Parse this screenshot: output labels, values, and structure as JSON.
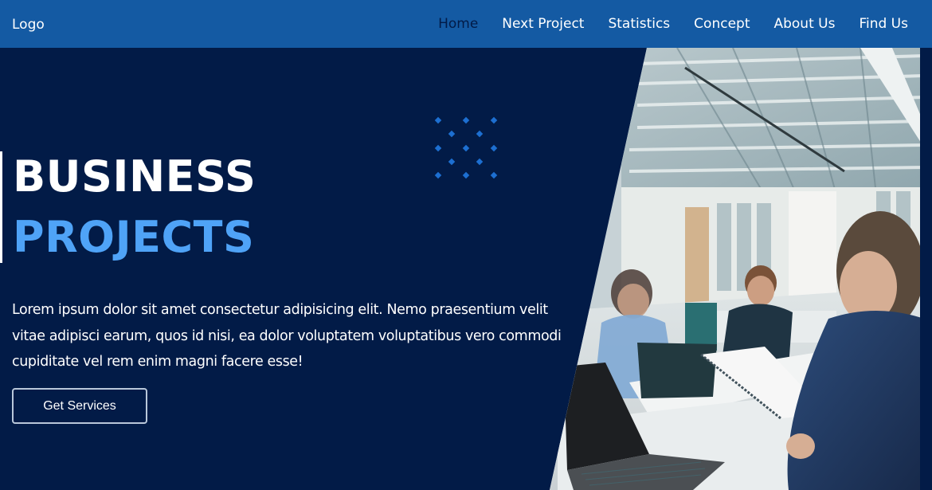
{
  "navbar": {
    "logo": "Logo",
    "links": [
      {
        "label": "Home",
        "active": true
      },
      {
        "label": "Next Project",
        "active": false
      },
      {
        "label": "Statistics",
        "active": false
      },
      {
        "label": "Concept",
        "active": false
      },
      {
        "label": "About Us",
        "active": false
      },
      {
        "label": "Find Us",
        "active": false
      }
    ]
  },
  "hero": {
    "title_line1": "BUSINESS",
    "title_line2": "PROJECTS",
    "description": "Lorem ipsum dolor sit amet consectetur adipisicing elit. Nemo praesentium velit vitae adipisci earum, quos id nisi, ea dolor voluptatem voluptatibus vero commodi cupiditate vel rem enim magni facere esse!",
    "cta_label": "Get Services"
  },
  "colors": {
    "navbar_bg": "#145aa3",
    "page_bg": "#021b47",
    "accent": "#4fa3f7",
    "active_link": "#021b47"
  },
  "icons": {
    "dot_pattern": "decorative-diamond-dots"
  }
}
